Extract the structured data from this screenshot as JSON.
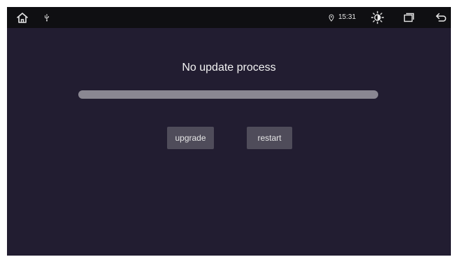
{
  "status_bar": {
    "time": "15:31",
    "icons": {
      "home": "home-icon",
      "usb": "usb-icon",
      "location": "location-icon",
      "brightness": "brightness-icon",
      "recents": "recents-icon",
      "back": "back-icon"
    }
  },
  "main": {
    "title": "No update process",
    "progress": 0,
    "buttons": {
      "upgrade_label": "upgrade",
      "restart_label": "restart"
    }
  },
  "colors": {
    "background": "#221d31",
    "status_bar": "#0f0f12",
    "progress_track": "#8a8792",
    "button": "#4f4c5a",
    "text": "#f2f2f2"
  }
}
